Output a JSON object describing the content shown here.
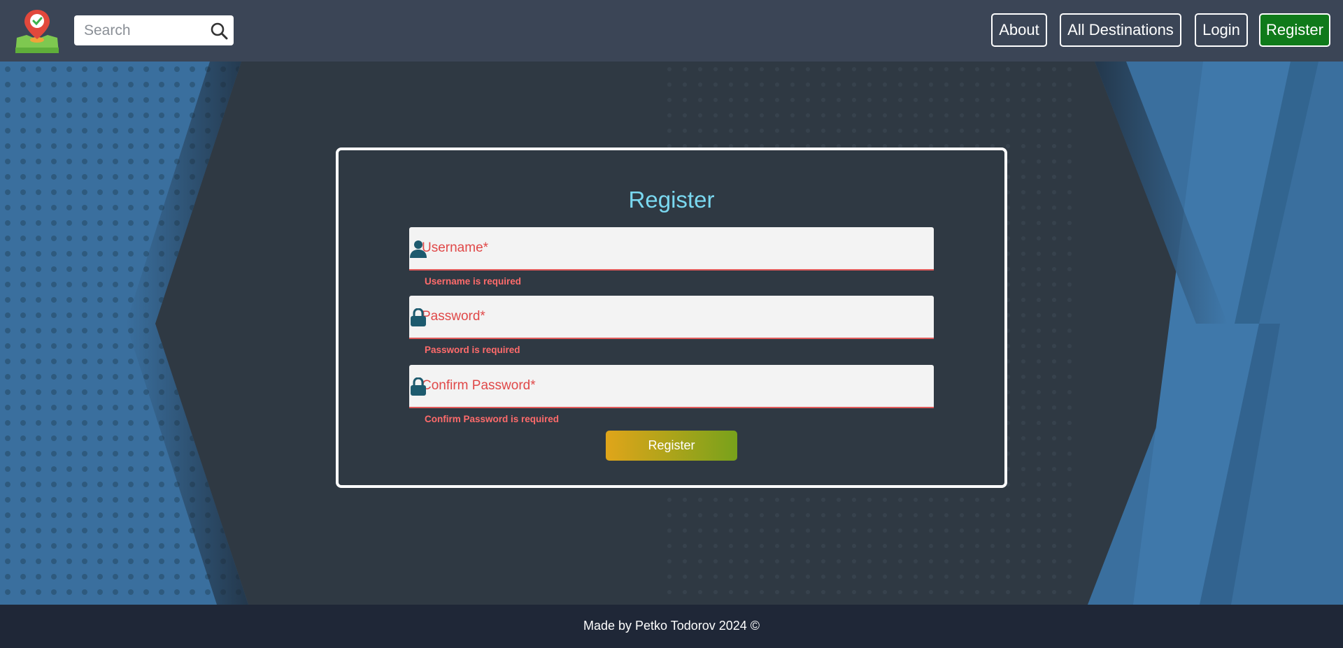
{
  "header": {
    "search": {
      "placeholder": "Search"
    },
    "nav": [
      {
        "label": "About"
      },
      {
        "label": "All Destinations"
      },
      {
        "label": "Login"
      },
      {
        "label": "Register"
      }
    ]
  },
  "form": {
    "title": "Register",
    "fields": [
      {
        "placeholder": "Username*",
        "error": "Username is required",
        "icon": "user-icon"
      },
      {
        "placeholder": "Password*",
        "error": "Password is required",
        "icon": "lock-icon"
      },
      {
        "placeholder": "Confirm Password*",
        "error": "Confirm Password is required",
        "icon": "lock-icon"
      }
    ],
    "submit_label": "Register"
  },
  "footer": {
    "text": "Made by Petko Todorov 2024 ©"
  },
  "colors": {
    "header_bg": "#3b4556",
    "accent_title": "#7ad8f0",
    "error": "#e04848",
    "register_nav": "#0f7a1a",
    "footer_bg": "#1f2737"
  }
}
